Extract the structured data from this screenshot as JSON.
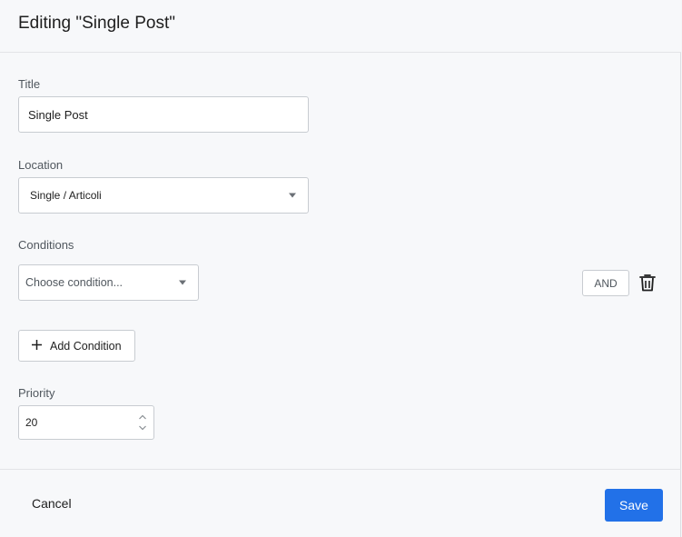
{
  "header": {
    "title": "Editing \"Single Post\""
  },
  "title_field": {
    "label": "Title",
    "value": "Single Post"
  },
  "location_field": {
    "label": "Location",
    "selected": "Single / Articoli"
  },
  "conditions": {
    "label": "Conditions",
    "select_placeholder": "Choose condition...",
    "and_label": "AND",
    "add_label": "Add Condition"
  },
  "priority_field": {
    "label": "Priority",
    "value": "20"
  },
  "footer": {
    "cancel_label": "Cancel",
    "save_label": "Save"
  },
  "colors": {
    "primary": "#2271e8",
    "border": "#c8ccd1",
    "background": "#f7f8fa"
  }
}
